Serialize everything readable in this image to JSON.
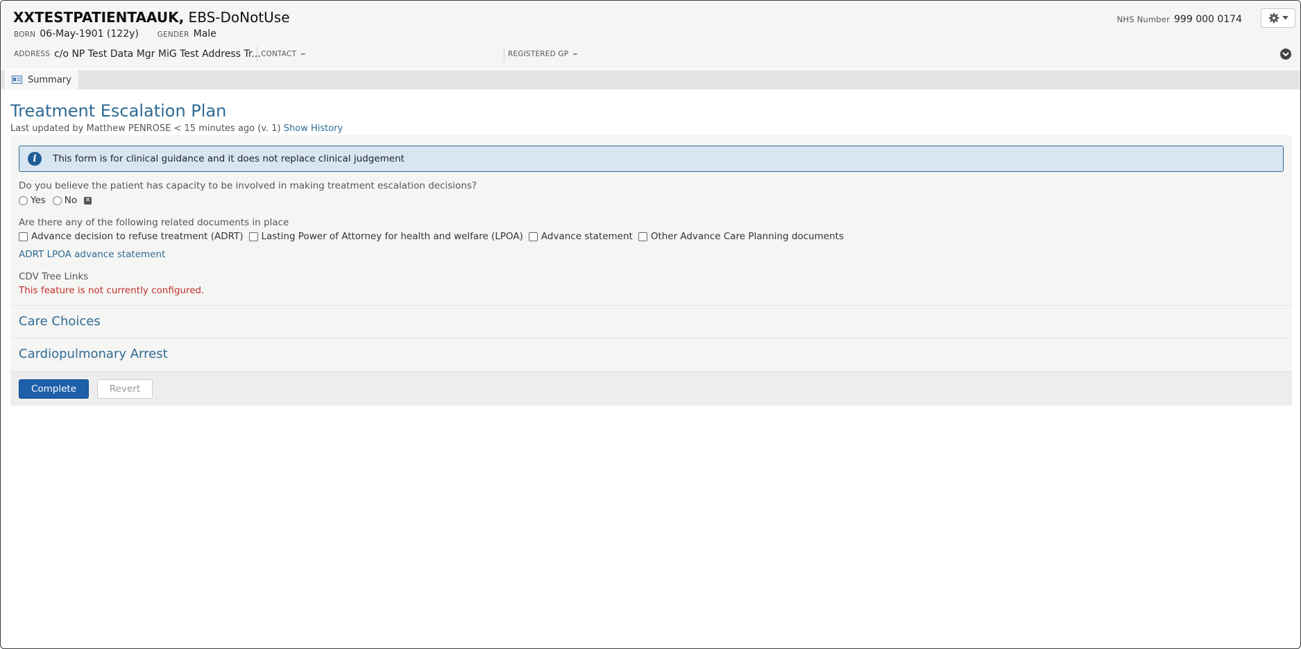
{
  "patient": {
    "surname": "XXTESTPATIENTAAUK,",
    "given": " EBS-DoNotUse",
    "born_label": "BORN",
    "born_value": "06-May-1901 (122y)",
    "gender_label": "GENDER",
    "gender_value": "Male",
    "nhs_label": "NHS Number",
    "nhs_value": "999 000 0174",
    "address_label": "ADDRESS",
    "address_value": "c/o NP Test Data Mgr MiG Test Address Tr...",
    "contact_label": "CONTACT",
    "contact_value": "–",
    "gp_label": "REGISTERED GP",
    "gp_value": "–"
  },
  "tabs": [
    {
      "label": "Summary",
      "icon": "summary-card-icon"
    }
  ],
  "page": {
    "title": "Treatment Escalation Plan",
    "updated_prefix": "Last updated by Matthew PENROSE < 15 minutes ago (v. 1)",
    "show_history": "Show History"
  },
  "form": {
    "info_text": "This form is for clinical guidance and it does not replace clinical judgement",
    "capacity_question": "Do you believe the patient has capacity to be involved in making treatment escalation decisions?",
    "capacity_options": [
      "Yes",
      "No"
    ],
    "docs_question": "Are there any of the following related documents in place",
    "doc_options": [
      "Advance decision to refuse treatment (ADRT)",
      "Lasting Power of Attorney for health and welfare (LPOA)",
      "Advance statement",
      "Other Advance Care Planning documents"
    ],
    "docs_link": "ADRT LPOA advance statement",
    "cdv_label": "CDV Tree Links",
    "cdv_error": "This feature is not currently configured.",
    "sections": [
      "Care Choices",
      "Cardiopulmonary Arrest"
    ],
    "complete_label": "Complete",
    "revert_label": "Revert"
  },
  "colors": {
    "accent": "#2e6b94",
    "primary_button": "#1d5fa8",
    "error": "#c0302a",
    "info_bg": "#d8e6f2"
  }
}
